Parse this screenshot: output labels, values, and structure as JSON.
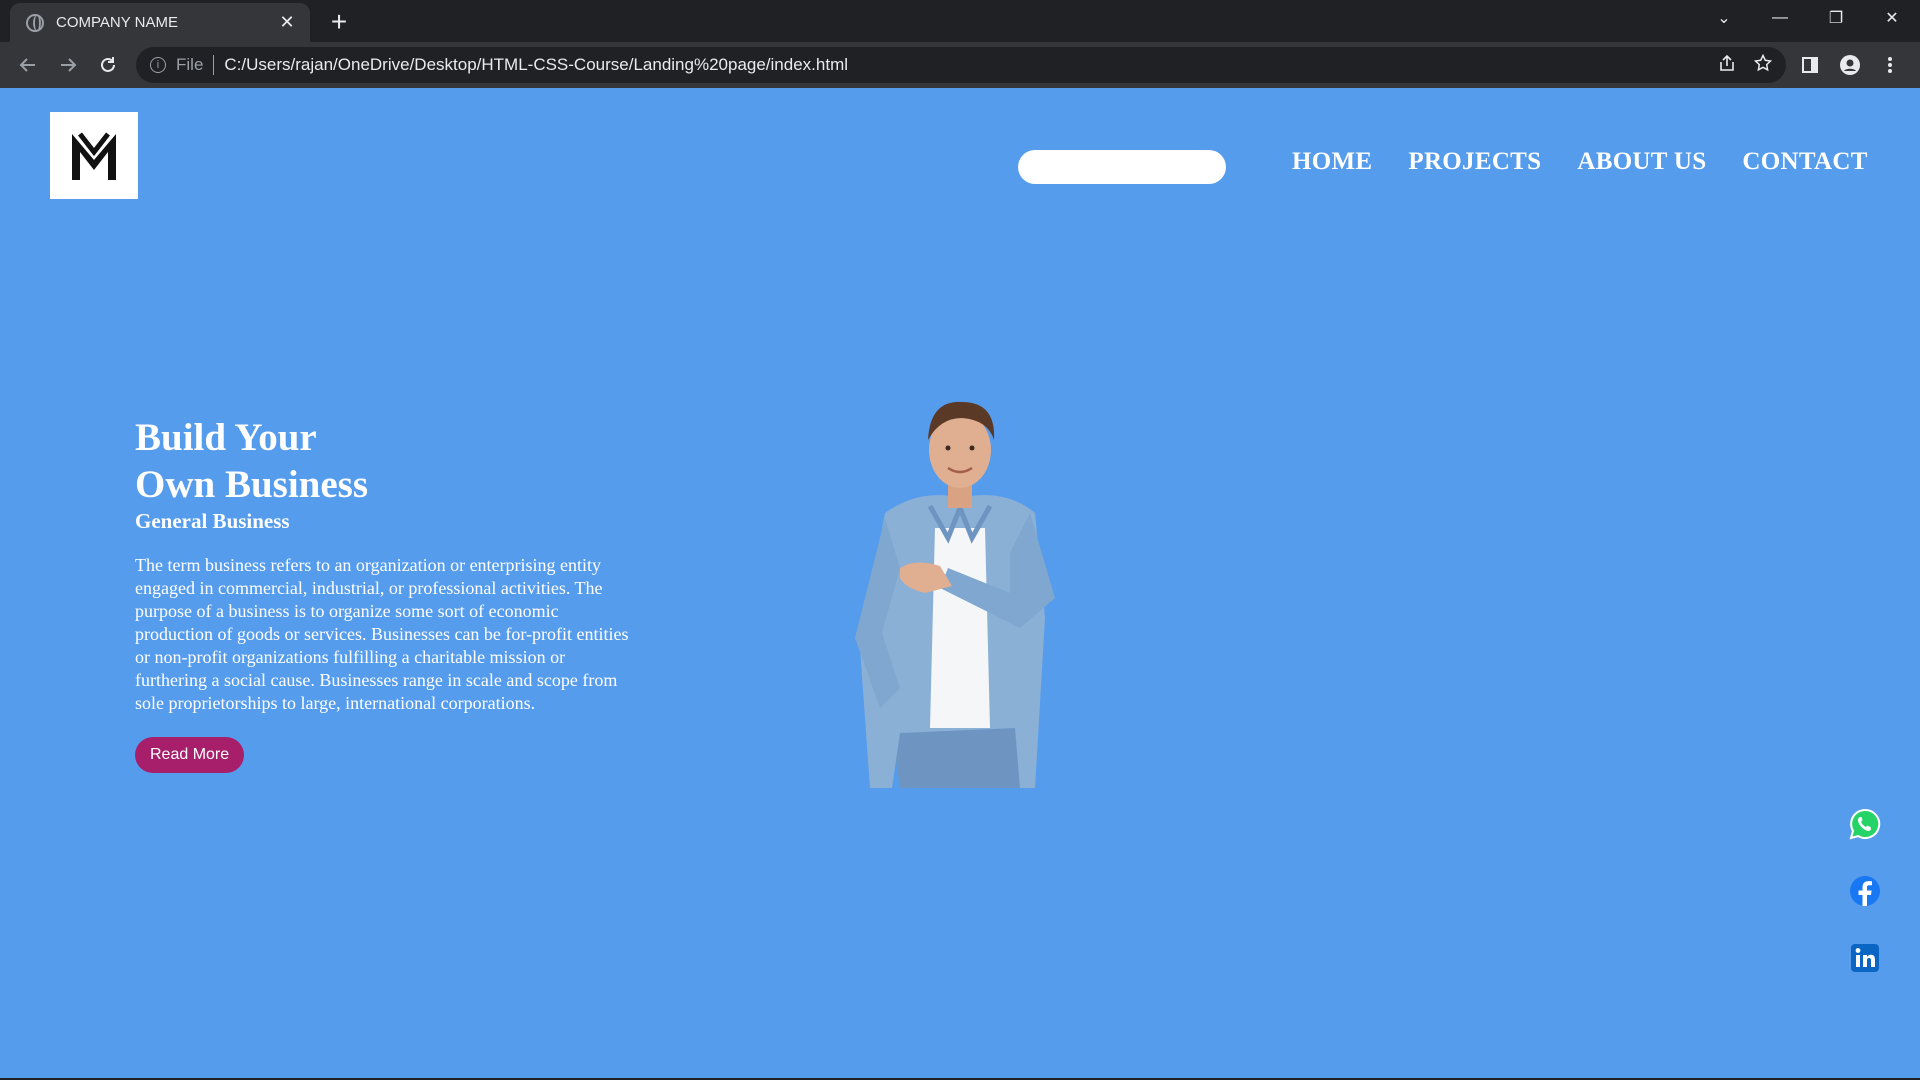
{
  "browser": {
    "tab_title": "COMPANY NAME",
    "tab_close": "✕",
    "new_tab": "+",
    "scheme_label": "File",
    "url": "C:/Users/rajan/OneDrive/Desktop/HTML-CSS-Course/Landing%20page/index.html",
    "window_controls": {
      "dropdown": "⌄",
      "minimize": "—",
      "restore": "❐",
      "close": "✕"
    }
  },
  "page": {
    "background_color": "#569cec",
    "search": {
      "value": "",
      "placeholder": ""
    },
    "nav": {
      "home": "HOME",
      "projects": "PROJECTS",
      "about": "ABOUT US",
      "contact": "CONTACT"
    },
    "hero": {
      "title_line1": "Build Your",
      "title_line2": "Own Business",
      "subtitle": "General Business",
      "body": "The term business refers to an organization or enterprising entity engaged in commercial, industrial, or professional activities. The purpose of a business is to organize some sort of economic production of goods or services. Businesses can be for-profit entities or non-profit organizations fulfilling a charitable mission or furthering a social cause. Businesses range in scale and scope from sole proprietorships to large, international corporations.",
      "button": "Read More",
      "button_color": "#a71e6a"
    },
    "social_icons": [
      "whatsapp-icon",
      "facebook-icon",
      "linkedin-icon"
    ]
  }
}
